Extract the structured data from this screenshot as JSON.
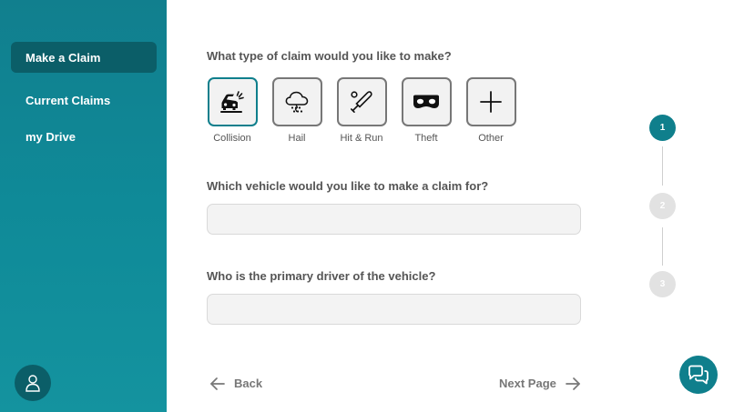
{
  "sidebar": {
    "items": [
      {
        "label": "Make a Claim",
        "active": true
      },
      {
        "label": "Current Claims",
        "active": false
      },
      {
        "label": "my Drive",
        "active": false
      }
    ],
    "avatar_icon": "user-icon"
  },
  "form": {
    "claim_type_question": "What type of claim would you like to make?",
    "claim_types": [
      {
        "label": "Collision",
        "icon": "collision-icon",
        "selected": true
      },
      {
        "label": "Hail",
        "icon": "hail-cloud-icon",
        "selected": false
      },
      {
        "label": "Hit & Run",
        "icon": "bat-icon",
        "selected": false
      },
      {
        "label": "Theft",
        "icon": "mask-icon",
        "selected": false
      },
      {
        "label": "Other",
        "icon": "plus-icon",
        "selected": false
      }
    ],
    "vehicle_question": "Which vehicle would you like to make a claim for?",
    "vehicle_value": "",
    "driver_question": "Who is the primary driver of the vehicle?",
    "driver_value": ""
  },
  "navigation": {
    "back_label": "Back",
    "next_label": "Next Page"
  },
  "stepper": {
    "steps": [
      "1",
      "2",
      "3"
    ],
    "current": 1
  },
  "colors": {
    "accent": "#0f7f8c",
    "sidebar_active": "#0b5e68"
  },
  "chat": {
    "icon": "chat-bubbles-icon"
  }
}
